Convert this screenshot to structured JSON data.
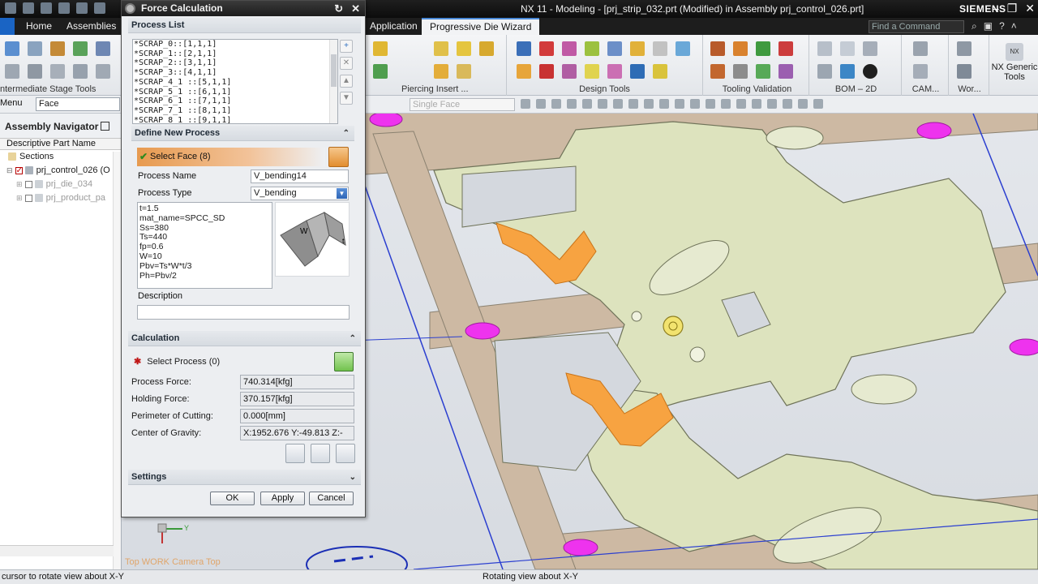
{
  "window": {
    "title": "NX 11 - Modeling - [prj_strip_032.prt (Modified)  in Assembly prj_control_026.prt]",
    "brand": "SIEMENS",
    "command_finder_placeholder": "Find a Command"
  },
  "tabs": [
    "Home",
    "Assemblies",
    "Application",
    "Progressive Die Wizard"
  ],
  "active_tab": "Progressive Die Wizard",
  "ribbon": {
    "groups": [
      "ntermediate Stage Tools",
      "Piercing Insert ...",
      "Design Tools",
      "Tooling Validation",
      "BOM – 2D",
      "CAM...",
      "Wor..."
    ],
    "nx_generic": "NX Generic Tools"
  },
  "selection_bar": {
    "menu_label": "Menu",
    "filter_value": "Face",
    "scope_value": "Single Face"
  },
  "navigator": {
    "title": "Assembly Navigator",
    "column": "Descriptive Part Name",
    "rows": [
      {
        "label": "Sections"
      },
      {
        "label": "prj_control_026 (O"
      },
      {
        "label": "prj_die_034"
      },
      {
        "label": "prj_product_pa"
      }
    ]
  },
  "viewport": {
    "view_label": "Top WORK Camera Top",
    "axis_y": "Y"
  },
  "status": {
    "left": "cursor to rotate view about X-Y",
    "middle": "Rotating view about X-Y"
  },
  "dialog": {
    "title": "Force Calculation",
    "process_list": {
      "heading": "Process List",
      "items": [
        "*SCRAP_0::[1,1,1]",
        "*SCRAP_1::[2,1,1]",
        "*SCRAP_2::[3,1,1]",
        "*SCRAP_3::[4,1,1]",
        "*SCRAP_4_1 ::[5,1,1]",
        "*SCRAP_5_1 ::[6,1,1]",
        "*SCRAP_6_1 ::[7,1,1]",
        "*SCRAP_7_1 ::[8,1,1]",
        "*SCRAP_8_1 ::[9,1,1]"
      ]
    },
    "define_new": {
      "heading": "Define New Process",
      "select_face": "Select Face (8)",
      "process_name_label": "Process Name",
      "process_name_value": "V_bending14",
      "process_type_label": "Process Type",
      "process_type_value": "V_bending",
      "formula_lines": [
        "t=1.5",
        "mat_name=SPCC_SD",
        "Ss=380",
        "Ts=440",
        "fp=0.6",
        "W=10",
        "Pbv=Ts*W*t/3",
        "Ph=Pbv/2"
      ],
      "image_labels": [
        "W",
        "t"
      ],
      "description_label": "Description",
      "description_value": ""
    },
    "calculation": {
      "heading": "Calculation",
      "select_process": "Select Process  (0)",
      "rows": [
        {
          "label": "Process Force:",
          "value": "740.314[kfg]"
        },
        {
          "label": "Holding Force:",
          "value": "370.157[kfg]"
        },
        {
          "label": "Perimeter of Cutting:",
          "value": "0.000[mm]"
        },
        {
          "label": "Center of Gravity:",
          "value": "X:1952.676 Y:-49.813 Z:-"
        }
      ]
    },
    "settings": {
      "heading": "Settings"
    },
    "buttons": {
      "ok": "OK",
      "apply": "Apply",
      "cancel": "Cancel"
    }
  },
  "colors": {
    "part_fill": "#dde3be",
    "highlight_face": "#f7a341",
    "hole_marker": "#ee33ee",
    "strip": "#cdb9a3",
    "active_tab_border": "#4a89d6"
  }
}
